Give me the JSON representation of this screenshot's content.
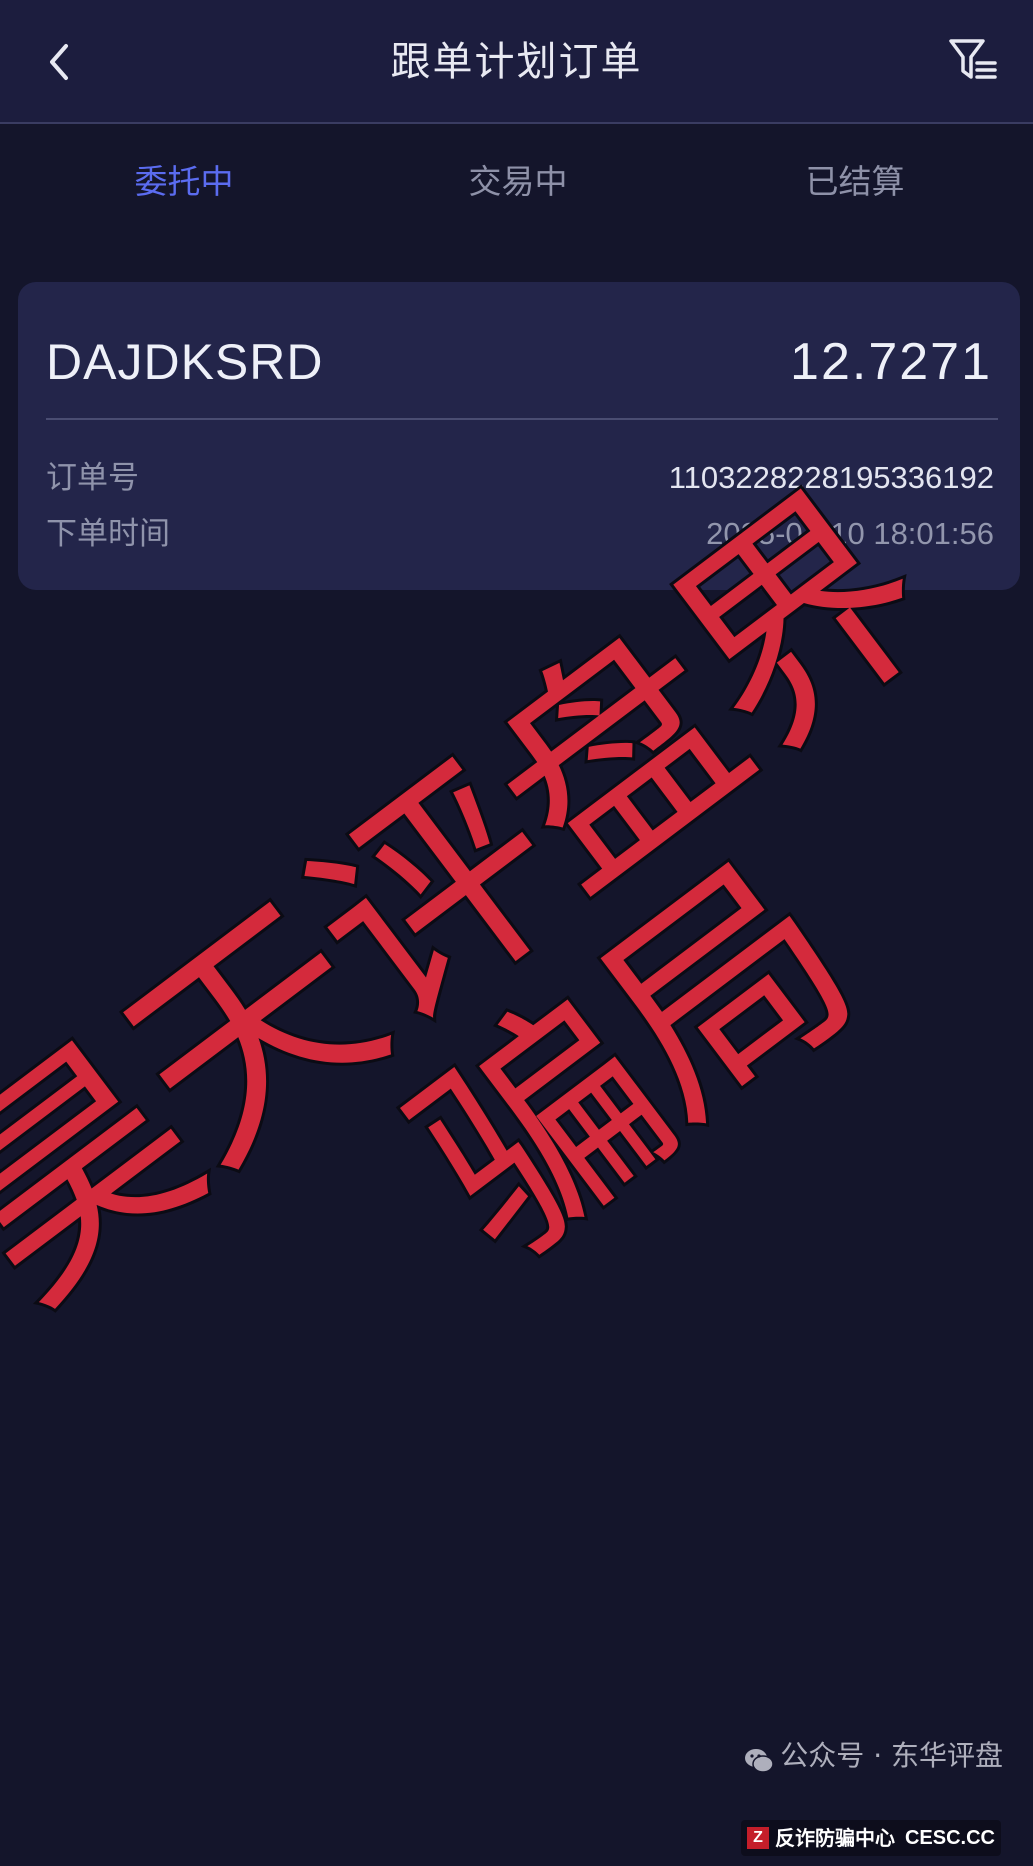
{
  "header": {
    "title": "跟单计划订单"
  },
  "tabs": [
    {
      "label": "委托中",
      "active": true
    },
    {
      "label": "交易中",
      "active": false
    },
    {
      "label": "已结算",
      "active": false
    }
  ],
  "order": {
    "symbol": "DAJDKSRD",
    "amount": "12.7271",
    "order_no_label": "订单号",
    "order_no": "1103228228195336192",
    "time_label": "下单时间",
    "time": "2025-07-10 18:01:56"
  },
  "watermark": {
    "line1": "昊天评盘界",
    "line2": "骗局",
    "color": "#d42a3c"
  },
  "footer": {
    "credit": "公众号 · 东华评盘",
    "badge_logo": "Z",
    "badge_text": "反诈防骗中心",
    "badge_site": "CESC.CC"
  },
  "colors": {
    "background": "#14152b",
    "header": "#1c1d3e",
    "card": "#23254a",
    "active_tab": "#5b6cf0"
  },
  "icons": [
    "back-chevron-icon",
    "filter-icon",
    "wechat-icon"
  ]
}
